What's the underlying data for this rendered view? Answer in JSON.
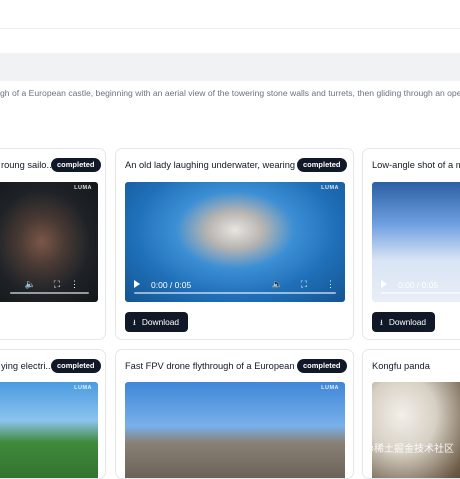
{
  "prompt_text": "gh of a European castle, beginning with an aerial view of the towering stone walls and turrets, then gliding through an open window",
  "status_completed": "completed",
  "video_brand": "LUMA",
  "download_label": "Download",
  "cards_row1": [
    {
      "title": "roung sailo...",
      "time": "",
      "status": "completed"
    },
    {
      "title": "An old lady laughing underwater, wearing ...",
      "time": "0:00 / 0:05",
      "status": "completed"
    },
    {
      "title": "Low-angle shot of a m",
      "time": "0:00 / 0:05",
      "status": ""
    }
  ],
  "cards_row2": [
    {
      "title": "ying electri...",
      "status": "completed"
    },
    {
      "title": "Fast FPV drone flythrough of a European ...",
      "status": "completed"
    },
    {
      "title": "Kongfu panda",
      "status": ""
    }
  ],
  "watermark": "@稀土掘金技术社区",
  "icons": [
    "play-icon",
    "volume-icon",
    "fullscreen-icon",
    "more-icon",
    "download-icon"
  ]
}
